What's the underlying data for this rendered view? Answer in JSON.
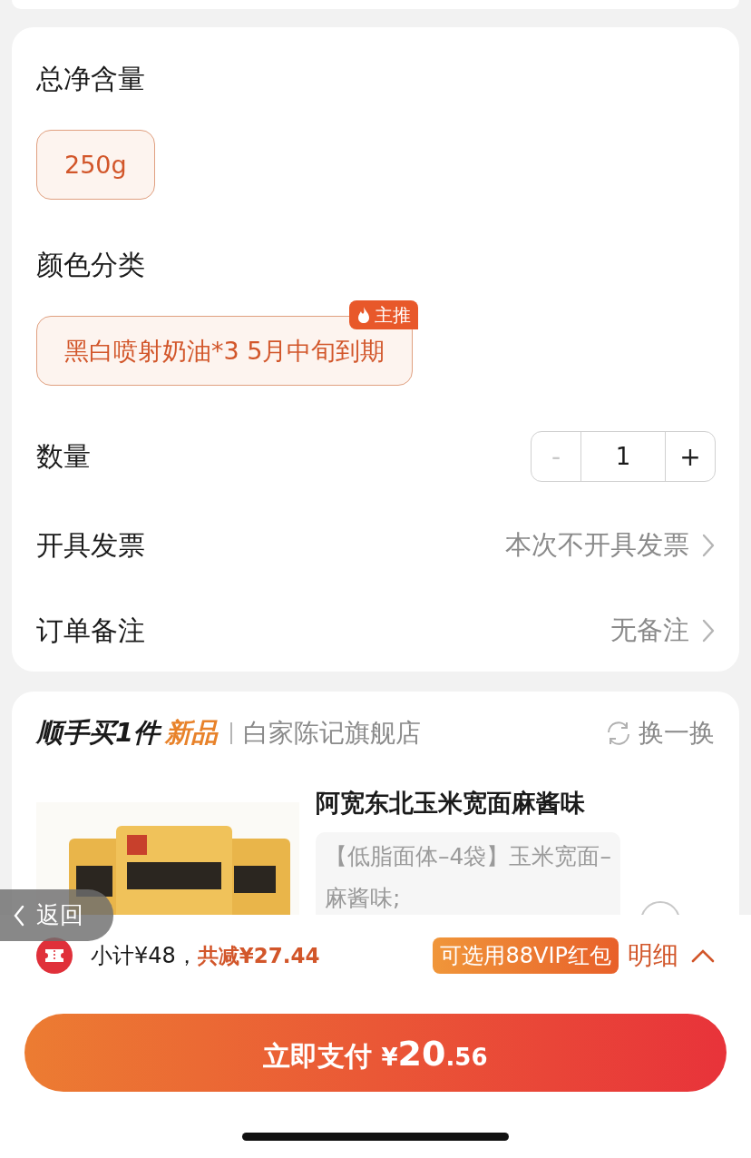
{
  "specs": [
    {
      "title": "总净含量",
      "options": [
        {
          "label": "250g",
          "selected": true
        }
      ]
    },
    {
      "title": "颜色分类",
      "options": [
        {
          "label": "黑白喷射奶油*3 5月中旬到期",
          "selected": true,
          "badge": "主推"
        }
      ]
    }
  ],
  "quantity": {
    "label": "数量",
    "minus": "-",
    "value": "1",
    "plus": "+",
    "minus_disabled": true
  },
  "rows": [
    {
      "label": "开具发票",
      "value": "本次不开具发票"
    },
    {
      "label": "订单备注",
      "value": "无备注"
    }
  ],
  "addon": {
    "title": "顺手买1件",
    "highlight": "新品",
    "shop": "白家陈记旗舰店",
    "refresh": "换一换",
    "product": {
      "kind": "picture",
      "name": "阿宽东北玉米宽面麻酱味",
      "sku": "【低脂面体–4袋】玉米宽面–麻酱味;",
      "selected": false
    }
  },
  "back_button": "返回",
  "summary": {
    "subtotal": "小计¥48，",
    "discount": "共减¥27.44",
    "vip": "可选用88VIP红包",
    "detail": "明细"
  },
  "pay": {
    "label": "立即支付",
    "currency": "¥",
    "integer": "20",
    "decimal": ".56"
  }
}
